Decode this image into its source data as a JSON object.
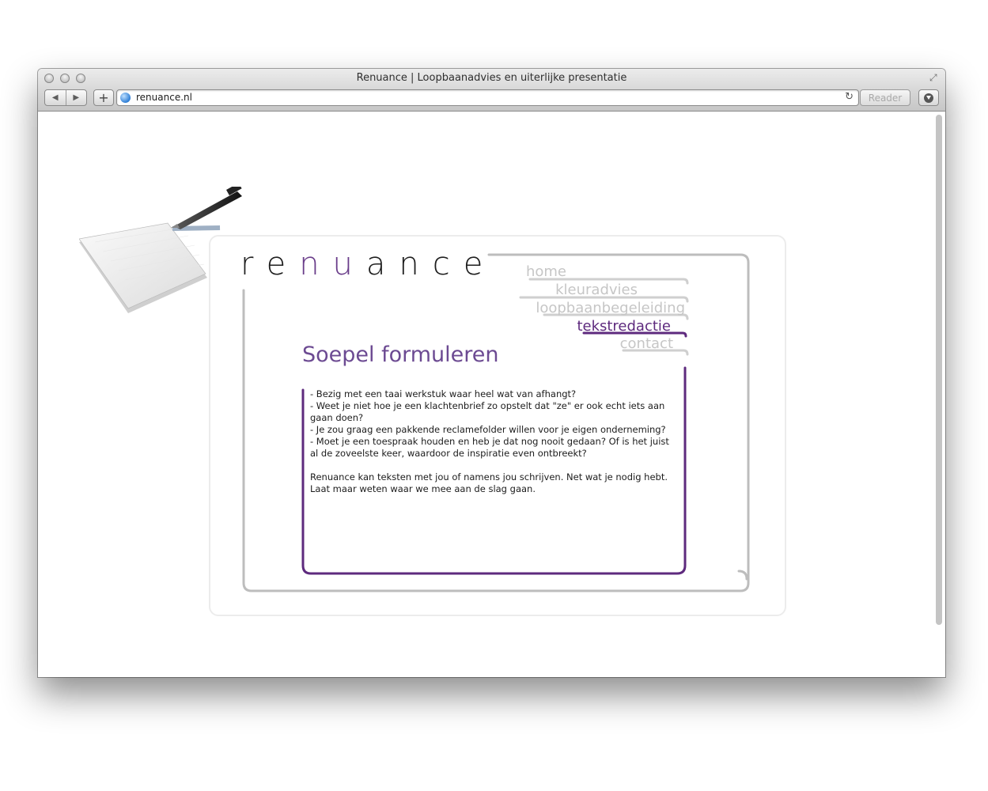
{
  "browser": {
    "window_title": "Renuance | Loopbaanadvies en uiterlijke presentatie",
    "url": "renuance.nl",
    "back_glyph": "◀",
    "forward_glyph": "▶",
    "add_glyph": "+",
    "reload_glyph": "↻",
    "resize_glyph": "⤢",
    "reader_label": "Reader",
    "icons": [
      "back-icon",
      "forward-icon",
      "add-bookmark-icon",
      "globe-icon",
      "reload-icon",
      "download-icon",
      "resize-icon"
    ]
  },
  "site": {
    "logo": {
      "letters": [
        "r",
        "e",
        "n",
        "u",
        "a",
        "n",
        "c",
        "e"
      ],
      "accent_letters": [
        2,
        3
      ]
    },
    "nav": [
      {
        "label": "home",
        "active": false
      },
      {
        "label": "kleuradvies",
        "active": false
      },
      {
        "label": "loopbaanbegeleiding",
        "active": false
      },
      {
        "label": "tekstredactie",
        "active": true
      },
      {
        "label": "contact",
        "active": false
      }
    ],
    "heading": "Soepel formuleren",
    "paragraphs": [
      " - Bezig met een taai werkstuk waar heel wat van afhangt?",
      "- Weet je niet hoe je een klachtenbrief zo opstelt dat \"ze\" er ook echt iets aan gaan doen?",
      "- Je zou graag een pakkende reclamefolder willen voor je eigen onderneming?",
      "- Moet je een toespraak houden en heb je dat nog nooit gedaan? Of is het juist al de zoveelste keer, waardoor de inspiratie even ontbreekt?",
      "",
      "Renuance kan teksten met jou of namens jou schrijven. Net wat je nodig hebt.",
      "Laat maar weten waar we mee aan de slag gaan."
    ],
    "colors": {
      "accent_purple": "#5e2a7e",
      "heading_purple": "#6c4a92",
      "nav_inactive": "#c6c6c6",
      "frame_gray": "#bdbdbd"
    }
  }
}
